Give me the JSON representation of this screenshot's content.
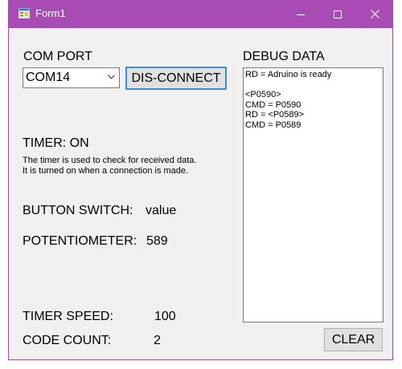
{
  "window": {
    "title": "Form1",
    "accent_color": "#a84bb4",
    "icons": [
      "app-icon",
      "minimize-icon",
      "maximize-icon",
      "close-icon"
    ]
  },
  "com_port": {
    "label": "COM PORT",
    "selected_value": "COM14",
    "connect_button_label": "DIS-CONNECT"
  },
  "debug": {
    "label": "DEBUG DATA",
    "lines": [
      "RD = Adruino is ready",
      "",
      "<P0590>",
      "CMD = P0590",
      "RD = <P0589>",
      "CMD = P0589"
    ]
  },
  "timer": {
    "status_label": "TIMER: ON",
    "description": [
      "The timer is used to check for received data.",
      "It is turned on when a connection is made."
    ]
  },
  "button_switch": {
    "label": "BUTTON SWITCH:",
    "value": "value"
  },
  "potentiometer": {
    "label": "POTENTIOMETER:",
    "value": "589"
  },
  "timer_speed": {
    "label": "TIMER SPEED:",
    "value": "100"
  },
  "code_count": {
    "label": "CODE COUNT:",
    "value": "2"
  },
  "clear_button_label": "CLEAR"
}
